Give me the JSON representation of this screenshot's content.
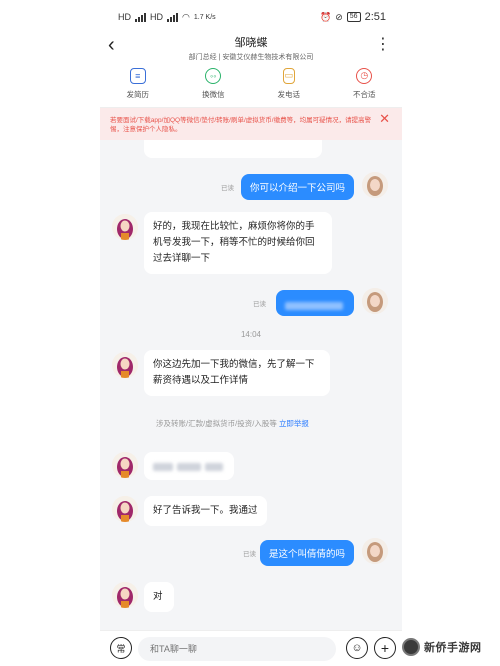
{
  "status_bar": {
    "left_network_1": "HD",
    "left_network_2": "HD",
    "wifi_speed": "1.7 K/s",
    "battery": "56",
    "time": "2:51"
  },
  "header": {
    "contact_name": "邹晓蝶",
    "contact_sub": "部门总经 | 安徽艾仪赫生物技术有限公司"
  },
  "actions": [
    {
      "label": "发简历",
      "icon": "resume-icon",
      "color": "#3a6fd8"
    },
    {
      "label": "换微信",
      "icon": "wechat-icon",
      "color": "#2bb36b"
    },
    {
      "label": "发电话",
      "icon": "phone-icon",
      "color": "#e0a53a"
    },
    {
      "label": "不合适",
      "icon": "clock-x-icon",
      "color": "#e8524a"
    }
  ],
  "warning": {
    "text": "若要面试/下载app/加QQ等微信/垫付/转账/刷单/虚拟货币/缴费等，均属可疑情况，请提高警惕，注意保护个人隐私。",
    "close": "✕"
  },
  "messages": [
    {
      "side": "out",
      "read": "已读",
      "text": "你可以介绍一下公司吗"
    },
    {
      "side": "in",
      "lines": [
        "好的，我现在比较忙，麻烦你将你的手",
        "机号发我一下，稍等不忙的时候给你回",
        "过去详聊一下"
      ]
    },
    {
      "side": "out",
      "read": "已读",
      "text": ""
    },
    {
      "side": "in",
      "lines": [
        "你这边先加一下我的微信，先了解一下",
        "薪资待遇以及工作详情"
      ]
    },
    {
      "side": "in",
      "text": ""
    },
    {
      "side": "in",
      "text": "好了告诉我一下。我通过"
    },
    {
      "side": "out",
      "read": "已读",
      "text": "是这个叫倩倩的吗"
    },
    {
      "side": "in",
      "text": "对"
    }
  ],
  "timestamp": "14:04",
  "notice": {
    "text": "涉及转账/汇款/虚拟货币/投资/入股等",
    "link": "立即举报"
  },
  "input": {
    "placeholder": "和TA聊一聊",
    "left_button": "常",
    "emoji": "☺",
    "plus": "+"
  },
  "watermark": "新侨手游网",
  "colors": {
    "accent": "#2b8cff",
    "warning_bg": "#fbeaea",
    "warning_text": "#e8524a"
  }
}
